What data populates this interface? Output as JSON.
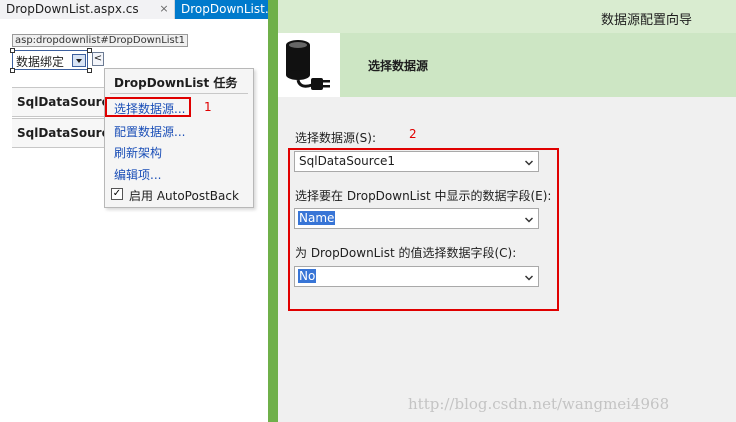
{
  "tabs": [
    {
      "label": "DropDownList.aspx.cs"
    },
    {
      "label": "DropDownList.aspx"
    }
  ],
  "designer": {
    "control_tag": "asp:dropdownlist#DropDownList1",
    "dropdown_text": "数据绑定",
    "smart_tag_glyph": "<",
    "datasources": [
      "SqlDataSource",
      "SqlDataSource"
    ],
    "task_panel": {
      "title": "DropDownList 任务",
      "links": [
        "选择数据源...",
        "配置数据源...",
        "刷新架构",
        "编辑项..."
      ],
      "autopostback": {
        "label": "启用 AutoPostBack",
        "checked": true
      }
    },
    "annotation_1": "1"
  },
  "wizard": {
    "title": "数据源配置向导",
    "step_title": "选择数据源",
    "annotation_2": "2",
    "fields": [
      {
        "label": "选择数据源(S):",
        "value": "SqlDataSource1",
        "highlighted": false
      },
      {
        "label": "选择要在 DropDownList 中显示的数据字段(E):",
        "value": "Name",
        "highlighted": true
      },
      {
        "label": "为 DropDownList 的值选择数据字段(C):",
        "value": "No",
        "highlighted": true
      }
    ],
    "watermark": "http://blog.csdn.net/wangmei4968"
  },
  "colors": {
    "wizard_frame": "#6fb04a",
    "wizard_header": "#cde6c4",
    "active_tab": "#007acc",
    "annotation": "#e00000",
    "selection": "#3875d6"
  }
}
